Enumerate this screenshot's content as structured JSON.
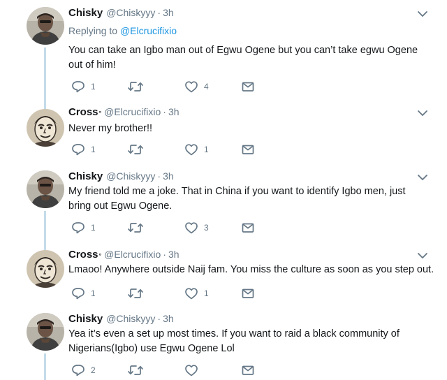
{
  "tweets": [
    {
      "name": "Chisky",
      "verified_mark": "",
      "handle": "@Chiskyyy",
      "time": "3h",
      "reply_prefix": "Replying to",
      "reply_mention": "@Elcrucifixio",
      "text_lines": [
        "You can take an Igbo man out of Egwu Ogene but you can’t take egwu Ogene",
        "out of him!"
      ],
      "reply_count": "1",
      "retweet_count": "",
      "like_count": "4",
      "avatar": "chisky"
    },
    {
      "name": "Cross",
      "verified_mark": "°",
      "handle": "@Elcrucifixio",
      "time": "3h",
      "text_lines": [
        "Never my brother!!"
      ],
      "reply_count": "1",
      "retweet_count": "",
      "like_count": "1",
      "avatar": "cross"
    },
    {
      "name": "Chisky",
      "verified_mark": "",
      "handle": "@Chiskyyy",
      "time": "3h",
      "text_lines": [
        "My friend told me a joke. That in China if you want to identify Igbo men, just",
        "bring out Egwu Ogene."
      ],
      "reply_count": "1",
      "retweet_count": "",
      "like_count": "3",
      "avatar": "chisky"
    },
    {
      "name": "Cross",
      "verified_mark": "°",
      "handle": "@Elcrucifixio",
      "time": "3h",
      "text_lines": [
        "Lmaoo! Anywhere outside Naij fam. You miss the culture as soon as you step out."
      ],
      "reply_count": "1",
      "retweet_count": "",
      "like_count": "1",
      "avatar": "cross"
    },
    {
      "name": "Chisky",
      "verified_mark": "",
      "handle": "@Chiskyyy",
      "time": "3h",
      "text_lines": [
        "Yea it’s even a set up most times. If you want to raid a black community of",
        "Nigerians(Igbo) use Egwu Ogene Lol"
      ],
      "reply_count": "2",
      "retweet_count": "",
      "like_count": "",
      "avatar": "chisky"
    }
  ],
  "separator": "·",
  "colors": {
    "text": "#14171a",
    "muted": "#657786",
    "link": "#1b95e0",
    "thread_line": "#c4dbea"
  },
  "icons": {
    "reply": "reply-icon",
    "retweet": "retweet-icon",
    "like": "like-icon",
    "message": "message-icon",
    "menu": "chevron-down-icon"
  }
}
